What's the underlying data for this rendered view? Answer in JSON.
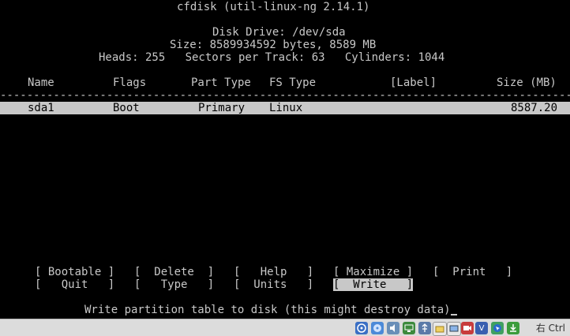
{
  "header": {
    "title": "cfdisk (util-linux-ng 2.14.1)",
    "disk_drive": "Disk Drive: /dev/sda",
    "size": "Size: 8589934592 bytes, 8589 MB",
    "geometry": "Heads: 255   Sectors per Track: 63   Cylinders: 1044"
  },
  "table": {
    "columns": {
      "name": "Name",
      "flags": "Flags",
      "part_type": "Part Type",
      "fs_type": "FS Type",
      "label": "[Label]",
      "size": "Size (MB)"
    },
    "divider": "------------------------------------------------------------------------------------------",
    "rows": [
      {
        "name": "sda1",
        "flags": "Boot",
        "part_type": "Primary",
        "fs_type": "Linux",
        "label": "",
        "size": "8587.20"
      }
    ]
  },
  "menu": {
    "bootable": "[ Bootable ]",
    "delete": "[  Delete  ]",
    "help": "[   Help   ]",
    "maximize": "[ Maximize ]",
    "print": "[  Print   ]",
    "quit": "[   Quit   ]",
    "type": "[   Type   ]",
    "units": "[  Units   ]",
    "write": "[  Write   ]",
    "selected": "write"
  },
  "status_message": "Write partition table to disk (this might destroy data)",
  "vm_statusbar": {
    "icons": [
      "hard-disk-icon",
      "optical-drive-icon",
      "audio-icon",
      "network-icon",
      "usb-icon",
      "shared-folders-icon",
      "display-icon",
      "video-capture-icon",
      "virtualization-icon",
      "mouse-integration-icon",
      "download-icon"
    ],
    "host_key": "右 Ctrl"
  },
  "colors": {
    "terminal_bg": "#000000",
    "terminal_fg": "#c8c8c8",
    "highlight_bg": "#c8c8c8",
    "highlight_fg": "#000000"
  }
}
